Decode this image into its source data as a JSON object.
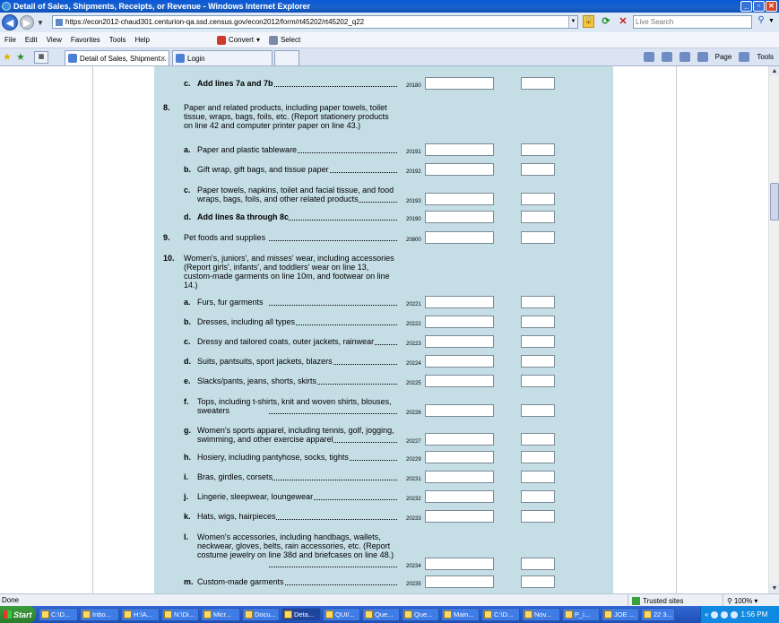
{
  "window": {
    "title": "Detail of Sales, Shipments, Receipts, or Revenue - Windows Internet Explorer"
  },
  "address_bar": {
    "url": "https://econ2012-chaud301.centurion-qa.ssd.census.gov/econ2012/form/rt45202/rt45202_q22",
    "search_placeholder": "Live Search"
  },
  "menu": {
    "items": [
      "File",
      "Edit",
      "View",
      "Favorites",
      "Tools",
      "Help"
    ],
    "convert_label": "Convert",
    "select_label": "Select"
  },
  "tabs": [
    {
      "label": "Detail of Sales, Shipment...",
      "active": true
    },
    {
      "label": "Login",
      "active": false
    }
  ],
  "tab_tools": {
    "page_label": "Page",
    "tools_label": "Tools"
  },
  "form": {
    "rows": [
      {
        "num": "",
        "letter": "c.",
        "text": "Add lines 7a and 7b",
        "bold": true,
        "code": "20180"
      },
      {
        "num": "8.",
        "letter": "",
        "text": "Paper and related products, including paper towels, toilet tissue, wraps, bags, foils, etc. (Report stationery products on line 42 and computer printer paper on line 43.)",
        "bold": false,
        "code": ""
      },
      {
        "num": "",
        "letter": "a.",
        "text": "Paper and plastic tableware",
        "bold": false,
        "code": "20191"
      },
      {
        "num": "",
        "letter": "b.",
        "text": "Gift wrap, gift bags, and tissue paper",
        "bold": false,
        "code": "20192"
      },
      {
        "num": "",
        "letter": "c.",
        "text": "Paper towels, napkins, toilet and facial tissue, and food wraps, bags, foils, and other related products",
        "bold": false,
        "code": "20193"
      },
      {
        "num": "",
        "letter": "d.",
        "text": "Add lines 8a through 8c",
        "bold": true,
        "code": "20190"
      },
      {
        "num": "9.",
        "letter": "",
        "text": "Pet foods and supplies",
        "bold": false,
        "code": "20800"
      },
      {
        "num": "10.",
        "letter": "",
        "text": "Women's, juniors', and misses' wear, including accessories (Report girls', infants', and toddlers' wear on line 13, custom-made garments on line 10m, and footwear on line 14.)",
        "bold": false,
        "code": ""
      },
      {
        "num": "",
        "letter": "a.",
        "text": "Furs, fur garments",
        "bold": false,
        "code": "20221"
      },
      {
        "num": "",
        "letter": "b.",
        "text": "Dresses, including all types",
        "bold": false,
        "code": "20222"
      },
      {
        "num": "",
        "letter": "c.",
        "text": "Dressy and tailored coats, outer jackets, rainwear",
        "bold": false,
        "code": "20223"
      },
      {
        "num": "",
        "letter": "d.",
        "text": "Suits, pantsuits, sport jackets, blazers",
        "bold": false,
        "code": "20224"
      },
      {
        "num": "",
        "letter": "e.",
        "text": "Slacks/pants, jeans, shorts, skirts",
        "bold": false,
        "code": "20225"
      },
      {
        "num": "",
        "letter": "f.",
        "text": "Tops, including t-shirts, knit and woven shirts, blouses, sweaters",
        "bold": false,
        "code": "20226"
      },
      {
        "num": "",
        "letter": "g.",
        "text": "Women's sports apparel, including tennis, golf, jogging, swimming, and other exercise apparel",
        "bold": false,
        "code": "20227"
      },
      {
        "num": "",
        "letter": "h.",
        "text": "Hosiery, including pantyhose, socks, tights",
        "bold": false,
        "code": "20229"
      },
      {
        "num": "",
        "letter": "i.",
        "text": "Bras, girdles, corsets",
        "bold": false,
        "code": "20231"
      },
      {
        "num": "",
        "letter": "j.",
        "text": "Lingerie, sleepwear, loungewear",
        "bold": false,
        "code": "20232"
      },
      {
        "num": "",
        "letter": "k.",
        "text": "Hats, wigs, hairpieces",
        "bold": false,
        "code": "20233"
      },
      {
        "num": "",
        "letter": "l.",
        "text": "Women's accessories, including handbags, wallets, neckwear, gloves, belts, rain accessories, etc. (Report costume jewelry on line 38d and briefcases on line 48.)",
        "bold": false,
        "code": "20234"
      },
      {
        "num": "",
        "letter": "m.",
        "text": "Custom-made garments",
        "bold": false,
        "code": "20235"
      }
    ]
  },
  "status_bar": {
    "text": "Done",
    "zone": "Trusted sites",
    "zoom": "100%"
  },
  "taskbar": {
    "start_label": "Start",
    "tasks": [
      "C:\\D...",
      "Inbo...",
      "H:\\A...",
      "N:\\Di...",
      "Micr...",
      "Docu...",
      "Deta...",
      "QUI/...",
      "Que...",
      "Que...",
      "Main...",
      "C:\\D...",
      "Nov...",
      "P_i...",
      "JOE ...",
      "22 3..."
    ],
    "clock": "1:56 PM"
  }
}
